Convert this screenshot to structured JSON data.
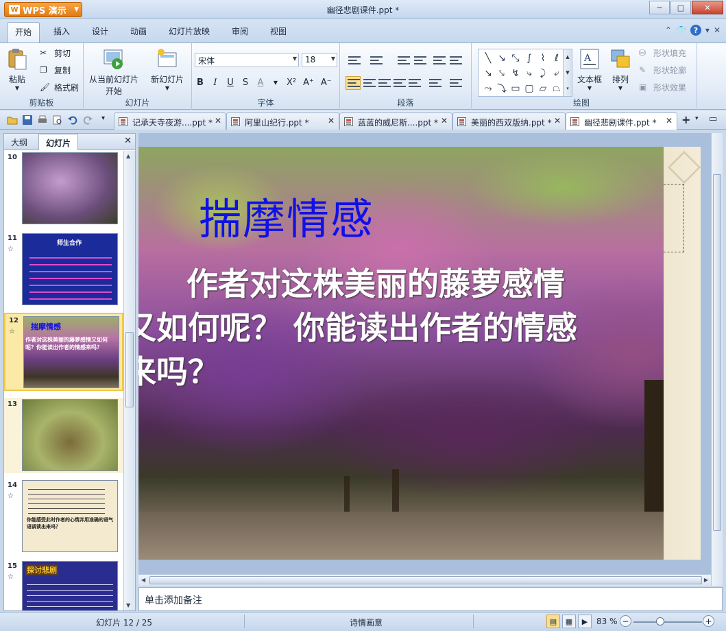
{
  "app": {
    "menu_button": "WPS 演示",
    "window_title": "幽径悲剧课件.ppt *",
    "win_min": "─",
    "win_max": "□",
    "win_close": "✕"
  },
  "menu": {
    "tabs": [
      "开始",
      "插入",
      "设计",
      "动画",
      "幻灯片放映",
      "审阅",
      "视图"
    ],
    "active_index": 0
  },
  "ribbon": {
    "clipboard": {
      "label": "剪贴板",
      "paste": "粘贴",
      "cut": "剪切",
      "copy": "复制",
      "format_painter": "格式刷"
    },
    "slides": {
      "label": "幻灯片",
      "from_current_l1": "从当前幻灯片",
      "from_current_l2": "开始",
      "new_slide": "新幻灯片"
    },
    "font": {
      "label": "字体",
      "font_name": "宋体",
      "font_size": "18",
      "bold": "B",
      "italic": "I",
      "underline": "U",
      "strike": "S",
      "color": "A",
      "superscript": "X²",
      "grow": "A⁺",
      "shrink": "A⁻"
    },
    "paragraph": {
      "label": "段落"
    },
    "drawing": {
      "label": "绘图",
      "textbox": "文本框",
      "arrange": "排列",
      "shape_fill": "形状填充",
      "shape_outline": "形状轮廓",
      "shape_effect": "形状效果"
    }
  },
  "doctabs": [
    {
      "label": "记承天寺夜游....ppt *",
      "active": false
    },
    {
      "label": "阿里山纪行.ppt *",
      "active": false
    },
    {
      "label": "蓝蓝的威尼斯....ppt *",
      "active": false
    },
    {
      "label": "美丽的西双版纳.ppt *",
      "active": false
    },
    {
      "label": "幽径悲剧课件.ppt *",
      "active": true
    }
  ],
  "leftpane": {
    "tab_outline": "大纲",
    "tab_slides": "幻灯片",
    "close": "✕",
    "thumbs": [
      {
        "num": "10",
        "star": "",
        "title": ""
      },
      {
        "num": "11",
        "star": "☆",
        "title": "师生合作"
      },
      {
        "num": "12",
        "star": "☆",
        "title": "揣摩情感",
        "body": "作者对这株美丽的藤萝感情又如何呢？你能读出作者的情感来吗？"
      },
      {
        "num": "13",
        "star": "",
        "title": ""
      },
      {
        "num": "14",
        "star": "☆",
        "title": "",
        "body": "你能感受此时作者的心情并用准确的语气语调读出来吗？"
      },
      {
        "num": "15",
        "star": "☆",
        "title": "探讨悲剧"
      }
    ],
    "selected_index": 2
  },
  "slide": {
    "title": "揣摩情感",
    "body_line1": "作者对这株美丽的藤萝感情",
    "body_line2": "又如何呢？ 你能读出作者的情感",
    "body_line3": "来吗？"
  },
  "notes": {
    "placeholder": "单击添加备注"
  },
  "status": {
    "slide_counter": "幻灯片 12 / 25",
    "theme": "诗情画意",
    "zoom": "83 %",
    "zoom_level_percent": 83
  }
}
